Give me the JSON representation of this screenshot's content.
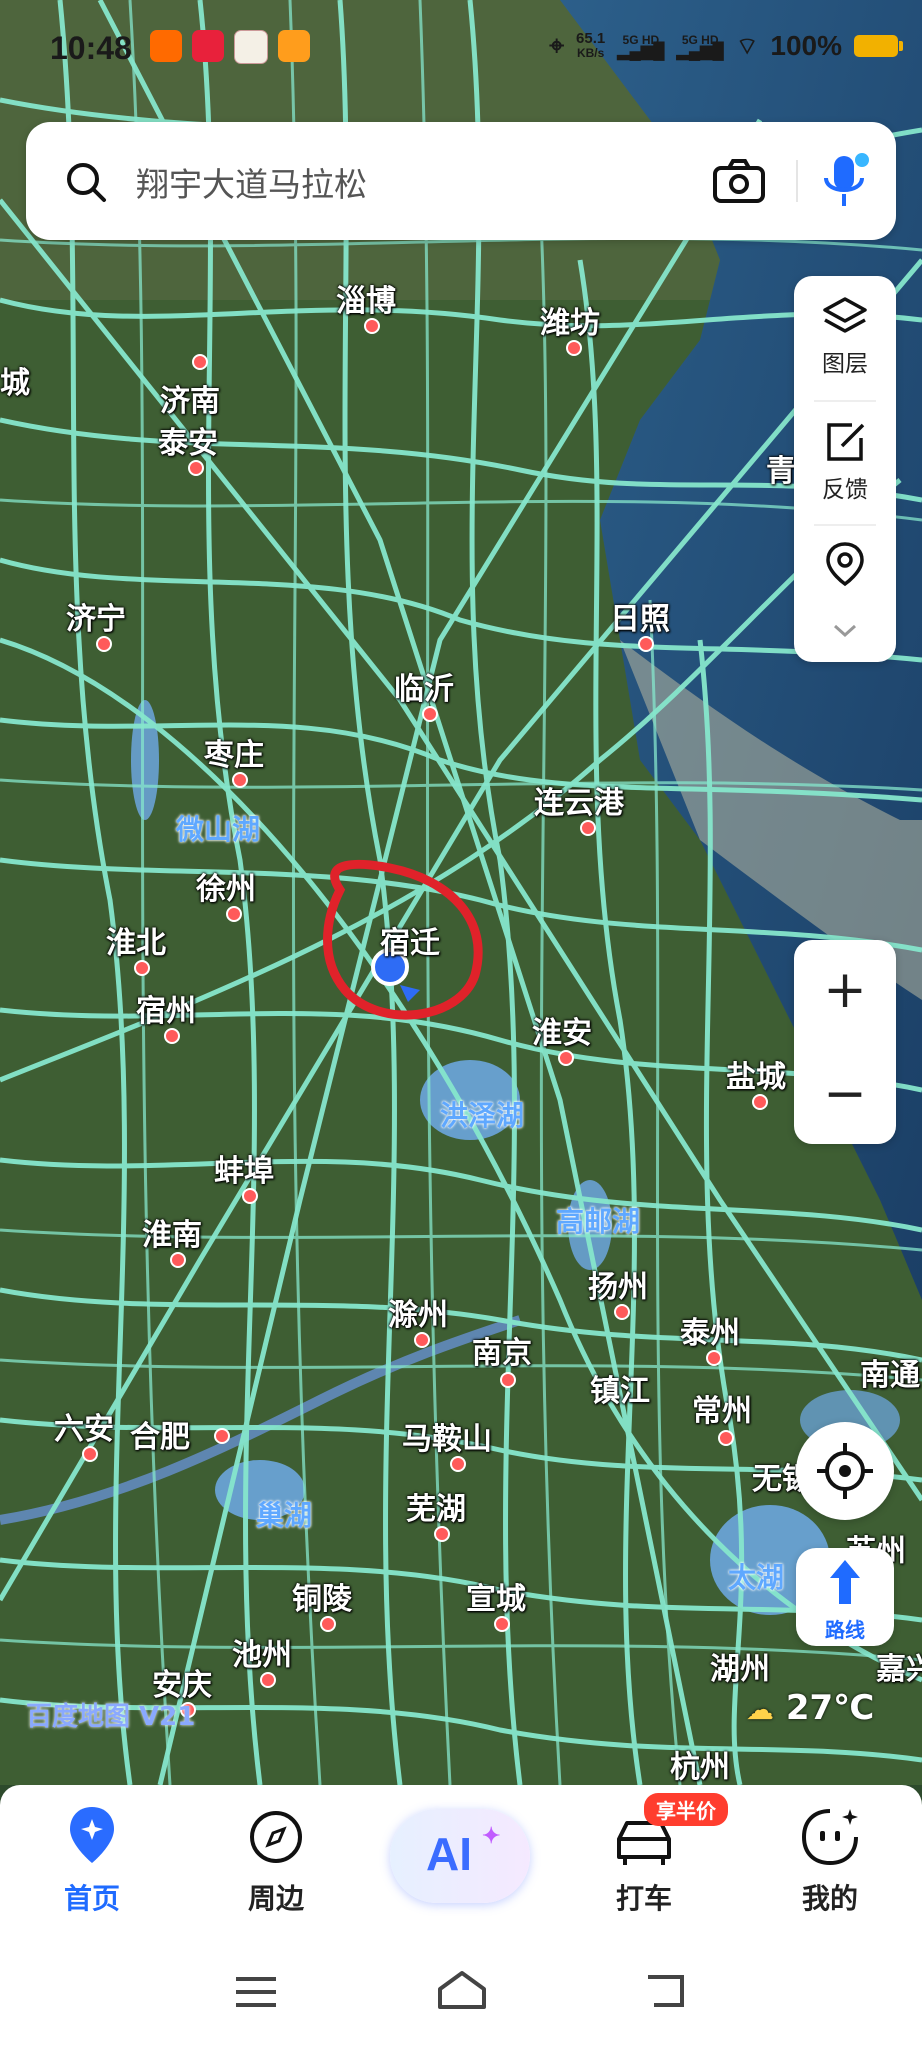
{
  "status_bar": {
    "time": "10:48",
    "net_speed": "65.1",
    "net_unit": "KB/s",
    "sim1": "5G HD",
    "sim2": "5G HD",
    "battery": "100%"
  },
  "search": {
    "placeholder": "翔宇大道马拉松"
  },
  "side_panel": {
    "layers_label": "图层",
    "feedback_label": "反馈"
  },
  "map": {
    "cities": [
      {
        "name": "淄博"
      },
      {
        "name": "潍坊"
      },
      {
        "name": "济南"
      },
      {
        "name": "泰安"
      },
      {
        "name": "济宁"
      },
      {
        "name": "日照"
      },
      {
        "name": "临沂"
      },
      {
        "name": "枣庄"
      },
      {
        "name": "连云港"
      },
      {
        "name": "徐州"
      },
      {
        "name": "淮北"
      },
      {
        "name": "宿迁"
      },
      {
        "name": "宿州"
      },
      {
        "name": "淮安"
      },
      {
        "name": "盐城"
      },
      {
        "name": "蚌埠"
      },
      {
        "name": "淮南"
      },
      {
        "name": "扬州"
      },
      {
        "name": "滁州"
      },
      {
        "name": "泰州"
      },
      {
        "name": "南京"
      },
      {
        "name": "镇江"
      },
      {
        "name": "常州"
      },
      {
        "name": "南通"
      },
      {
        "name": "六安"
      },
      {
        "name": "合肥"
      },
      {
        "name": "马鞍山"
      },
      {
        "name": "无锡"
      },
      {
        "name": "芜湖"
      },
      {
        "name": "苏州"
      },
      {
        "name": "铜陵"
      },
      {
        "name": "宣城"
      },
      {
        "name": "池州"
      },
      {
        "name": "湖州"
      },
      {
        "name": "嘉兴"
      },
      {
        "name": "安庆"
      },
      {
        "name": "杭州"
      },
      {
        "name": "城"
      },
      {
        "name": "青"
      }
    ],
    "lakes": [
      {
        "name": "微山湖"
      },
      {
        "name": "洪泽湖"
      },
      {
        "name": "高邮湖"
      },
      {
        "name": "巢湖"
      },
      {
        "name": "太湖"
      }
    ],
    "logo": "百度地图 V21",
    "temperature": "27℃"
  },
  "controls": {
    "zoom_in": "+",
    "zoom_out": "−",
    "route_label": "路线"
  },
  "tabbar": {
    "home": "首页",
    "nearby": "周边",
    "ai": "AI",
    "taxi": "打车",
    "taxi_badge": "享半价",
    "mine": "我的"
  },
  "colors": {
    "accent": "#1f6bff",
    "road": "#7ee0c8",
    "badge": "#ff3d2e"
  }
}
